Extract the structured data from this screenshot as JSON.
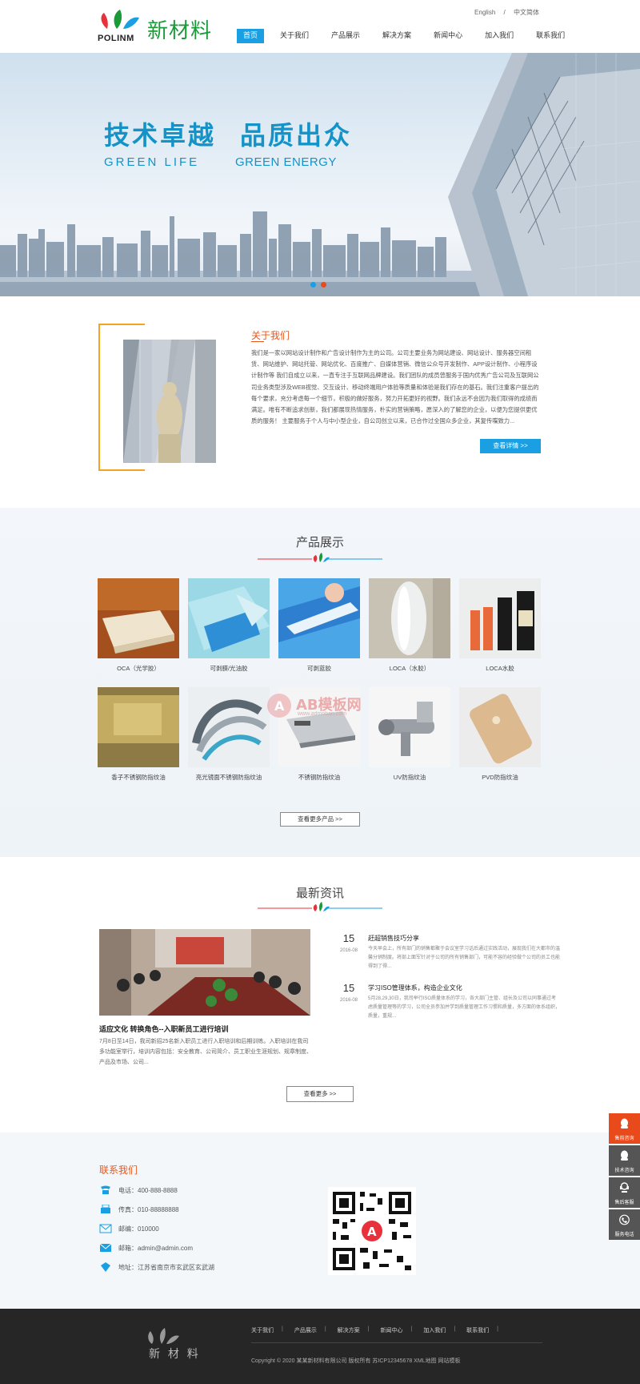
{
  "header": {
    "logo_en": "POLINM",
    "logo_cn": "新材料",
    "lang": [
      "English",
      "/",
      "中文简体"
    ],
    "nav": [
      "首页",
      "关于我们",
      "产品展示",
      "解决方案",
      "新闻中心",
      "加入我们",
      "联系我们"
    ]
  },
  "banner": {
    "title_left": "技术卓越",
    "title_right": "品质出众",
    "sub_left": "GREEN  LIFE",
    "sub_right": "GREEN ENERGY"
  },
  "about": {
    "title": "关于我们",
    "text": "我们是一家以网站设计制作和广告设计制作为主的公司。公司主要业务为网站建设、网站设计、服务器空间租赁、网站维护、网站托管、网站优化、百度推广、自媒体营销、微信公众号开发制作、APP设计制作、小程序设计制作等 我们自成立以来，一直专注于互联网品牌建设。我们团队的成员曾服务于国内优秀广告公司及互联网公司业务类型涉及WEB视觉、交互设计、移动终端用户体验等质量和体验是我们存在的基石。我们注重客户提出的每个要求，充分考虑每一个细节，积极的做好服务，努力开拓更好的视野。我们永远不会因为我们取得的成绩而满足。唯有不断追求创新，我们都展现热情服务，朴实的营销策略，愿深入的了解您的企业，以便为您提供更优质的服务！ 主要服务于个人与中小型企业，自公司创立以来，已合作过全国众多企业，其复传喋致力...",
    "button": "查看详情 >>"
  },
  "products": {
    "title": "产品展示",
    "items": [
      "OCA（光学胶）",
      "可剥膜/光油胶",
      "可剥蓝胶",
      "LOCA（水胶）",
      "LOCA水胶",
      "香子不锈钢防指纹油",
      "亮光镜面不锈钢防指纹油",
      "不锈钢防指纹油",
      "UV防指纹油",
      "PVD防指纹油"
    ],
    "more": "查看更多产品 >>"
  },
  "watermark": {
    "text": "AB模板网",
    "url": "www.admoban.com"
  },
  "news": {
    "title": "最新资讯",
    "main_title": "适应文化 转换角色--入职新员工进行培训",
    "main_text": "7月8日至14日，我司新招25名新入职员工进行入职培训和后期训练。入职培训在我司多功能室举行，培训内容包括：安全教育、公司简介、员工职业生涯规划、规章制度、产品及市场、公司...",
    "items": [
      {
        "day": "15",
        "date": "2016-08",
        "title": "赶超销售技巧分享",
        "text": "今天早会上，所有部门的销售都聚于会议室学习话后通过实践活动，展现我们在大都市的温馨分销制度。将部上面军针对于公司的所有销售部门，可能不容的经验做个公司的员工也能得到了得..."
      },
      {
        "day": "15",
        "date": "2016-08",
        "title": "学习ISO管理体系，构造企业文化",
        "text": "5月28,29,30日，我司举行ISO质量体系的学习，各大部门主管、组长及公司以同事通过考虑质量管理等的学习，公司全员参加并学到质量管理工作习惯和质量，多方面的体系组织，质量，重规..."
      }
    ],
    "more": "查看更多 >>"
  },
  "contact": {
    "title": "联系我们",
    "rows": [
      {
        "icon": "phone-icon",
        "text": "电话：400-888-8888"
      },
      {
        "icon": "fax-icon",
        "text": "传真：010-88888888"
      },
      {
        "icon": "postcode-icon",
        "text": "邮编：010000"
      },
      {
        "icon": "mail-icon",
        "text": "邮箱：admin@admin.com"
      },
      {
        "icon": "location-icon",
        "text": "地址：江苏省南京市玄武区玄武湖"
      }
    ]
  },
  "footer": {
    "logo_cn": "新 材 料",
    "nav": [
      "关于我们",
      "产品展示",
      "解决方案",
      "新闻中心",
      "加入我们",
      "联系我们"
    ],
    "copyright": "Copyright © 2020 某某新材料有限公司 版权所有  苏ICP12345678  XML地图  网站模板"
  },
  "side": [
    "售前咨询",
    "技术咨询",
    "售后客服",
    "服务电话"
  ],
  "colors": {
    "accent_blue": "#1aa0e2",
    "accent_orange": "#e8571c",
    "brand_green": "#1b9a3a",
    "side_red": "#e84a1c",
    "side_gray": "#555555"
  }
}
